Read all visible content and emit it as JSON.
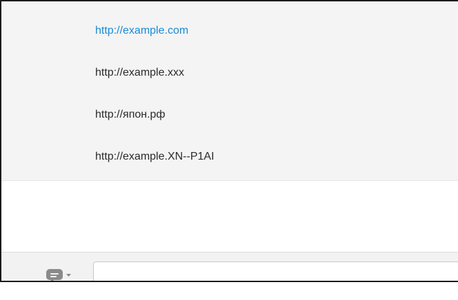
{
  "messages": [
    {
      "text": "http://example.com",
      "is_link": true
    },
    {
      "text": "http://example.xxx",
      "is_link": false
    },
    {
      "text": "http://япон.рф",
      "is_link": false
    },
    {
      "text": "http://example.XN--P1AI",
      "is_link": false
    }
  ],
  "composer": {
    "emoji_icon": "chat-bubble-icon",
    "dropdown_icon": "caret-down-icon",
    "input_value": "",
    "input_placeholder": ""
  },
  "colors": {
    "link": "#1a8ad4",
    "text": "#2a2a2a",
    "message_bg": "#f4f4f4",
    "composer_bg": "#f2f2f2",
    "icon": "#8a8a8a"
  }
}
